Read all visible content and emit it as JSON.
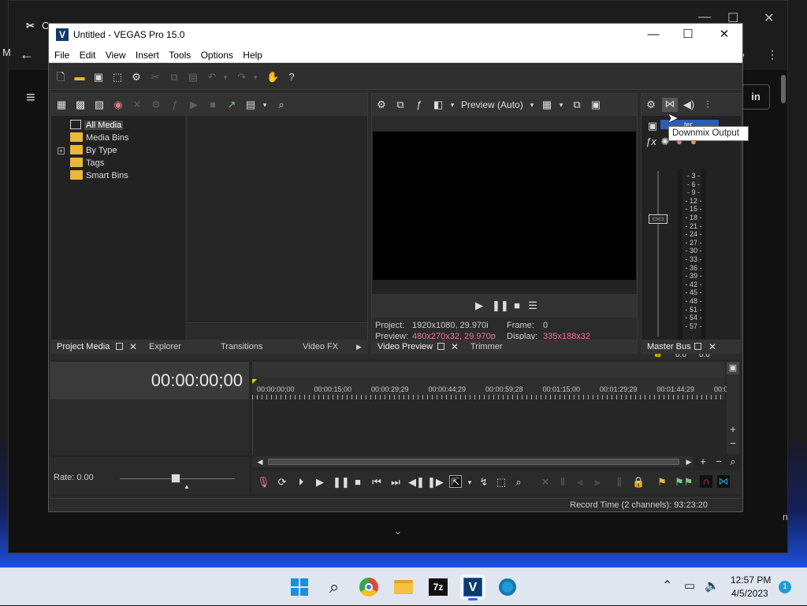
{
  "background_window": {
    "tab_label": "C",
    "left_letter": "M",
    "side_letter_1": "in",
    "side_letter_2": "n"
  },
  "window": {
    "title": "Untitled - VEGAS Pro 15.0",
    "logo_letter": "V",
    "minimize": "—",
    "maximize": "☐",
    "close": "✕"
  },
  "menu": [
    "File",
    "Edit",
    "View",
    "Insert",
    "Tools",
    "Options",
    "Help"
  ],
  "project_media": {
    "tree": [
      {
        "label": "All Media",
        "selected": true
      },
      {
        "label": "Media Bins"
      },
      {
        "label": "By Type",
        "expandable": true,
        "expander": "+"
      },
      {
        "label": "Tags"
      },
      {
        "label": "Smart Bins"
      }
    ],
    "tabs": [
      "Project Media",
      "Explorer",
      "Transitions",
      "Video FX"
    ]
  },
  "preview": {
    "quality": "Preview (Auto)",
    "project_label": "Project:",
    "project_value": "1920x1080, 29.970i",
    "preview_label": "Preview:",
    "preview_value": "480x270x32, 29.970p",
    "frame_label": "Frame:",
    "frame_value": "0",
    "display_label": "Display:",
    "display_value": "335x188x32",
    "tabs": [
      "Video Preview",
      "Trimmer"
    ],
    "accent_color": "#e07a8a"
  },
  "master_bus": {
    "tooltip": "Downmix Output",
    "label_fragment": "ter",
    "scale": [
      "3",
      "6",
      "9",
      "12",
      "15",
      "18",
      "21",
      "24",
      "27",
      "30",
      "33",
      "36",
      "39",
      "42",
      "45",
      "48",
      "51",
      "54",
      "57"
    ],
    "left_peak": "0.0",
    "right_peak": "0.0",
    "tab": "Master Bus"
  },
  "timeline": {
    "timecode": "00:00:00;00",
    "ruler": [
      "00:00:00;00",
      "00:00:15;00",
      "00:00:29;29",
      "00:00:44;29",
      "00:00:59;28",
      "00:01:15;00",
      "00:01:29;29",
      "00:01:44;29",
      "00:01"
    ],
    "rate": "Rate: 0.00",
    "status": "Record Time (2 channels): 93:23:20"
  },
  "taskbar": {
    "time": "12:57 PM",
    "date": "4/5/2023",
    "notification_count": "1",
    "apps": [
      "start",
      "search",
      "chrome",
      "file-explorer",
      "7zip",
      "vegas",
      "other-app"
    ],
    "app_7zip_label": "7z",
    "app_vegas_label": "V"
  },
  "colors": {
    "accent": "#1f9bd6",
    "folder": "#e9b73a",
    "playhead": "#e8d200"
  }
}
